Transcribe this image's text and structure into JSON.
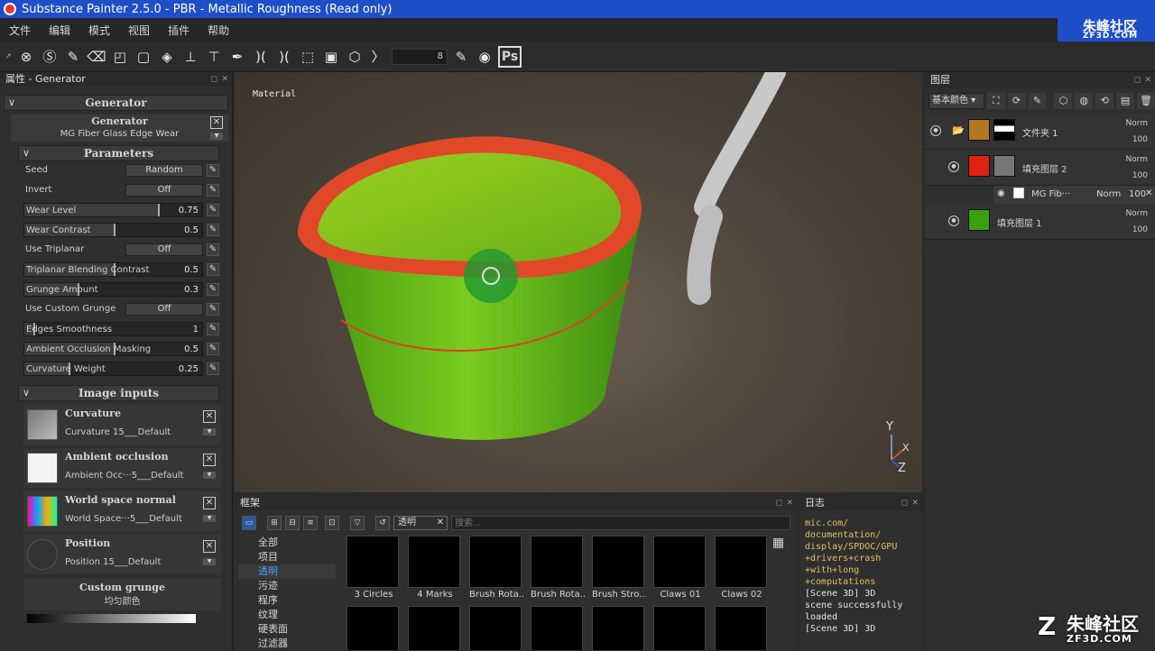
{
  "window": {
    "title": "Substance Painter 2.5.0 - PBR - Metallic Roughness (Read only)"
  },
  "menu": [
    "文件",
    "编辑",
    "模式",
    "视图",
    "插件",
    "帮助"
  ],
  "toolbar": {
    "field_value": "8",
    "ps_label": "Ps"
  },
  "properties": {
    "panel_title": "属性 - Generator",
    "generator_section": "Generator",
    "generator_label": "Generator",
    "generator_value": "MG Fiber Glass Edge Wear",
    "parameters_section": "Parameters",
    "params": [
      {
        "label": "Seed",
        "type": "button",
        "value": "Random"
      },
      {
        "label": "Invert",
        "type": "button",
        "value": "Off"
      },
      {
        "label": "Wear Level",
        "type": "slider",
        "value": "0.75",
        "fraction": 0.75
      },
      {
        "label": "Wear Contrast",
        "type": "slider",
        "value": "0.5",
        "fraction": 0.5
      },
      {
        "label": "Use Triplanar",
        "type": "button",
        "value": "Off"
      },
      {
        "label": "Triplanar Blending Contrast",
        "type": "slider",
        "value": "0.5",
        "fraction": 0.5
      },
      {
        "label": "Grunge Amount",
        "type": "slider",
        "value": "0.3",
        "fraction": 0.3
      },
      {
        "label": "Use Custom Grunge",
        "type": "button",
        "value": "Off"
      },
      {
        "label": "Edges Smoothness",
        "type": "slider",
        "value": "1",
        "fraction": 0.05
      },
      {
        "label": "Ambient Occlusion Masking",
        "type": "slider",
        "value": "0.5",
        "fraction": 0.5
      },
      {
        "label": "Curvature Weight",
        "type": "slider",
        "value": "0.25",
        "fraction": 0.25
      }
    ],
    "image_inputs_section": "Image inputs",
    "image_inputs": [
      {
        "title": "Curvature",
        "value": "Curvature 15___Default"
      },
      {
        "title": "Ambient occlusion",
        "value": "Ambient Occ···5___Default"
      },
      {
        "title": "World space normal",
        "value": "World Space···5___Default"
      },
      {
        "title": "Position",
        "value": "Position 15___Default"
      }
    ],
    "custom_grunge_title": "Custom grunge",
    "custom_grunge_value": "均匀颜色"
  },
  "viewport": {
    "label": "Material",
    "axis_y": "Y",
    "axis_x": "X",
    "axis_z": "Z"
  },
  "layers": {
    "panel_title": "图层",
    "blend_select": "基本颜色",
    "items": [
      {
        "name": "文件夹 1",
        "blend": "Norm",
        "opacity": "100",
        "color": "#b07820"
      },
      {
        "name": "填充图层 2",
        "blend": "Norm",
        "opacity": "100",
        "color": "#e02010"
      },
      {
        "name": "MG Fib···",
        "blend": "Norm",
        "opacity": "100"
      },
      {
        "name": "填充图层 1",
        "blend": "Norm",
        "opacity": "100",
        "color": "#3aa010"
      }
    ]
  },
  "shelf": {
    "panel_title": "框架",
    "filter_tag": "透明",
    "search_placeholder": "搜索...",
    "categories": [
      "全部",
      "项目",
      "透明",
      "污迹",
      "程序",
      "纹理",
      "硬表面",
      "过滤器"
    ],
    "selected_category": "透明",
    "tiles": [
      "3 Circles",
      "4 Marks",
      "Brush Rota...",
      "Brush Rota...",
      "Brush Stro...",
      "Claws 01",
      "Claws 02"
    ]
  },
  "log": {
    "panel_title": "日志",
    "lines": [
      "mic.com/",
      "documentation/",
      "display/SPDOC/GPU",
      "+drivers+crash",
      "+with+long",
      "+computations"
    ],
    "white_lines": [
      "[Scene 3D] 3D",
      "scene successfully",
      "loaded",
      "[Scene 3D] 3D"
    ]
  },
  "watermark": {
    "top_name": "朱峰社区",
    "top_site": "ZF3D.COM",
    "bottom_name": "朱峰社区",
    "bottom_site": "ZF3D.COM"
  }
}
